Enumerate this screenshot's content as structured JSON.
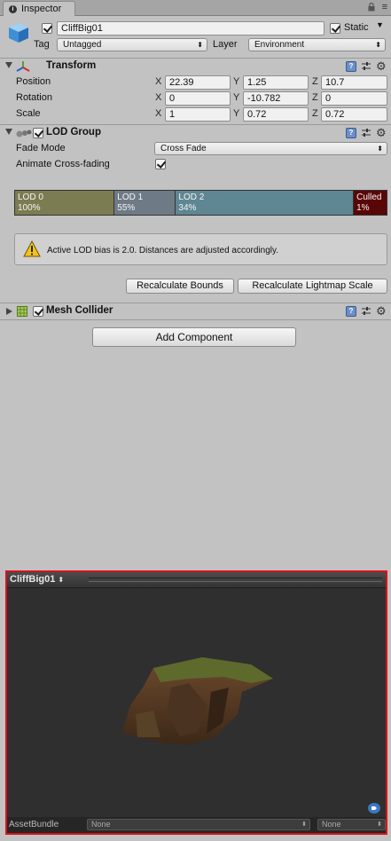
{
  "tab": {
    "label": "Inspector"
  },
  "object": {
    "name": "CliffBig01",
    "active": true,
    "static_label": "Static",
    "static": true,
    "tag_label": "Tag",
    "tag_value": "Untagged",
    "layer_label": "Layer",
    "layer_value": "Environment"
  },
  "transform": {
    "title": "Transform",
    "rows": [
      {
        "label": "Position",
        "x": "22.39",
        "y": "1.25",
        "z": "10.7"
      },
      {
        "label": "Rotation",
        "x": "0",
        "y": "-10.782",
        "z": "0"
      },
      {
        "label": "Scale",
        "x": "1",
        "y": "0.72",
        "z": "0.72"
      }
    ],
    "axis_x": "X",
    "axis_y": "Y",
    "axis_z": "Z"
  },
  "lod_group": {
    "title": "LOD Group",
    "enabled": true,
    "fade_mode_label": "Fade Mode",
    "fade_mode_value": "Cross Fade",
    "animate_label": "Animate Cross-fading",
    "animate": true,
    "levels": [
      {
        "name": "LOD 0",
        "percent": "100%",
        "share": 0.268,
        "color": "#7c7c52"
      },
      {
        "name": "LOD 1",
        "percent": "55%",
        "share": 0.165,
        "color": "#6f7a87"
      },
      {
        "name": "LOD 2",
        "percent": "34%",
        "share": 0.479,
        "color": "#5f8793"
      },
      {
        "name": "Culled",
        "percent": "1%",
        "share": 0.088,
        "color": "#5a0606"
      }
    ],
    "warning": "Active LOD bias is 2.0. Distances are adjusted accordingly.",
    "recalc_bounds": "Recalculate Bounds",
    "recalc_lightmap": "Recalculate Lightmap Scale"
  },
  "mesh_collider": {
    "title": "Mesh Collider",
    "enabled": true
  },
  "add_component": "Add Component",
  "preview": {
    "title": "CliffBig01",
    "asset_bundle_label": "AssetBundle",
    "bundle_value": "None",
    "variant_value": "None"
  },
  "colors": {
    "highlight": "#d8121b",
    "background": "#c2c2c2",
    "preview_bg": "#2f2f2f"
  }
}
